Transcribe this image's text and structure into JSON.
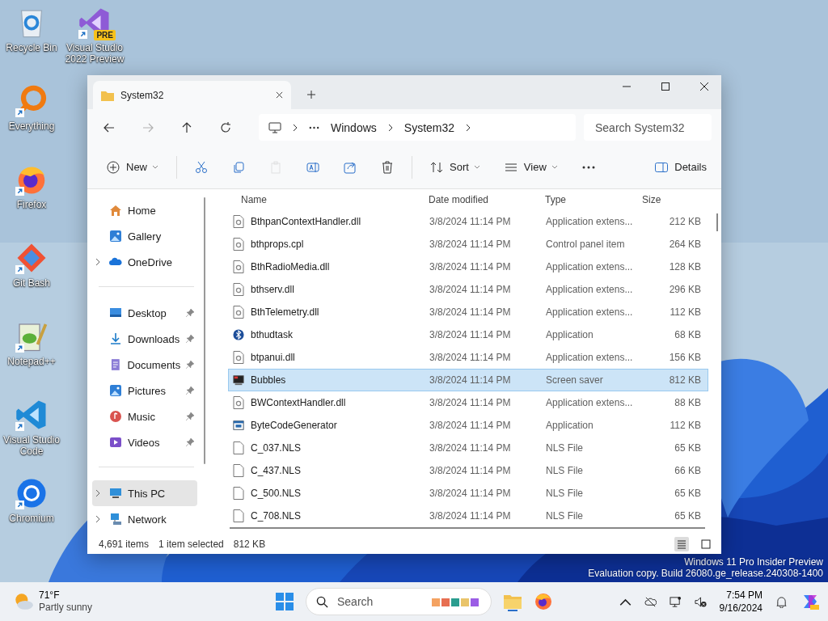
{
  "desktop_icons": [
    {
      "label": "Recycle Bin",
      "kind": "recycle",
      "shortcut": false
    },
    {
      "label": "Everything",
      "kind": "everything",
      "shortcut": true
    },
    {
      "label": "Firefox",
      "kind": "firefox",
      "shortcut": true
    },
    {
      "label": "Git Bash",
      "kind": "git",
      "shortcut": true
    },
    {
      "label": "Notepad++",
      "kind": "notepad",
      "shortcut": true
    },
    {
      "label": "Visual Studio Code",
      "kind": "vscode",
      "shortcut": true
    },
    {
      "label": "Chromium",
      "kind": "chromium",
      "shortcut": true
    },
    {
      "label": "Visual Studio 2022 Preview",
      "kind": "vs",
      "shortcut": true,
      "badge": "PRE"
    }
  ],
  "explorer": {
    "tab": {
      "title": "System32"
    },
    "address": [
      "Windows",
      "System32"
    ],
    "search": {
      "placeholder": "Search System32"
    },
    "toolbar": [
      {
        "kind": "new",
        "label": "New",
        "disabled": false
      },
      {
        "kind": "cut",
        "disabled": false
      },
      {
        "kind": "copy",
        "disabled": false
      },
      {
        "kind": "paste",
        "disabled": true
      },
      {
        "kind": "rename",
        "disabled": false
      },
      {
        "kind": "share",
        "disabled": false
      },
      {
        "kind": "delete",
        "disabled": false
      },
      {
        "kind": "sort",
        "label": "Sort",
        "disabled": false
      },
      {
        "kind": "view",
        "label": "View",
        "disabled": false
      },
      {
        "kind": "more",
        "disabled": false
      }
    ],
    "details_button": "Details",
    "sidebar": [
      [
        {
          "label": "Home",
          "kind": "home",
          "expandable": false,
          "pinned": false,
          "selected": false
        },
        {
          "label": "Gallery",
          "kind": "gallery",
          "expandable": false,
          "pinned": false,
          "selected": false
        },
        {
          "label": "OneDrive",
          "kind": "cloud",
          "expandable": true,
          "pinned": false,
          "selected": false
        }
      ],
      [
        {
          "label": "Desktop",
          "kind": "desktop",
          "expandable": false,
          "pinned": true,
          "selected": false
        },
        {
          "label": "Downloads",
          "kind": "download",
          "expandable": false,
          "pinned": true,
          "selected": false
        },
        {
          "label": "Documents",
          "kind": "document",
          "expandable": false,
          "pinned": true,
          "selected": false
        },
        {
          "label": "Pictures",
          "kind": "gallery",
          "expandable": false,
          "pinned": true,
          "selected": false
        },
        {
          "label": "Music",
          "kind": "music",
          "expandable": false,
          "pinned": true,
          "selected": false
        },
        {
          "label": "Videos",
          "kind": "video",
          "expandable": false,
          "pinned": true,
          "selected": false
        }
      ],
      [
        {
          "label": "This PC",
          "kind": "pc",
          "expandable": true,
          "pinned": false,
          "selected": true
        },
        {
          "label": "Network",
          "kind": "network",
          "expandable": true,
          "pinned": false,
          "selected": false
        }
      ]
    ],
    "columns": [
      "Name",
      "Date modified",
      "Type",
      "Size"
    ],
    "rows": [
      {
        "name": "BthpanContextHandler.dll",
        "date": "3/8/2024 11:14 PM",
        "type": "Application extens...",
        "size": "212 KB",
        "kind": "dll",
        "selected": false
      },
      {
        "name": "bthprops.cpl",
        "date": "3/8/2024 11:14 PM",
        "type": "Control panel item",
        "size": "264 KB",
        "kind": "dll",
        "selected": false
      },
      {
        "name": "BthRadioMedia.dll",
        "date": "3/8/2024 11:14 PM",
        "type": "Application extens...",
        "size": "128 KB",
        "kind": "dll",
        "selected": false
      },
      {
        "name": "bthserv.dll",
        "date": "3/8/2024 11:14 PM",
        "type": "Application extens...",
        "size": "296 KB",
        "kind": "dll",
        "selected": false
      },
      {
        "name": "BthTelemetry.dll",
        "date": "3/8/2024 11:14 PM",
        "type": "Application extens...",
        "size": "112 KB",
        "kind": "dll",
        "selected": false
      },
      {
        "name": "bthudtask",
        "date": "3/8/2024 11:14 PM",
        "type": "Application",
        "size": "68 KB",
        "kind": "bluetooth",
        "selected": false
      },
      {
        "name": "btpanui.dll",
        "date": "3/8/2024 11:14 PM",
        "type": "Application extens...",
        "size": "156 KB",
        "kind": "dll",
        "selected": false
      },
      {
        "name": "Bubbles",
        "date": "3/8/2024 11:14 PM",
        "type": "Screen saver",
        "size": "812 KB",
        "kind": "screensaver",
        "selected": true
      },
      {
        "name": "BWContextHandler.dll",
        "date": "3/8/2024 11:14 PM",
        "type": "Application extens...",
        "size": "88 KB",
        "kind": "dll",
        "selected": false
      },
      {
        "name": "ByteCodeGenerator",
        "date": "3/8/2024 11:14 PM",
        "type": "Application",
        "size": "112 KB",
        "kind": "app",
        "selected": false
      },
      {
        "name": "C_037.NLS",
        "date": "3/8/2024 11:14 PM",
        "type": "NLS File",
        "size": "65 KB",
        "kind": "file",
        "selected": false
      },
      {
        "name": "C_437.NLS",
        "date": "3/8/2024 11:14 PM",
        "type": "NLS File",
        "size": "66 KB",
        "kind": "file",
        "selected": false
      },
      {
        "name": "C_500.NLS",
        "date": "3/8/2024 11:14 PM",
        "type": "NLS File",
        "size": "65 KB",
        "kind": "file",
        "selected": false
      },
      {
        "name": "C_708.NLS",
        "date": "3/8/2024 11:14 PM",
        "type": "NLS File",
        "size": "65 KB",
        "kind": "file",
        "selected": false
      }
    ],
    "status": {
      "count": "4,691 items",
      "selection": "1 item selected",
      "size": "812 KB"
    },
    "view_modes": [
      {
        "kind": "details",
        "selected": true
      },
      {
        "kind": "tiles",
        "selected": false
      }
    ]
  },
  "watermark": [
    "Windows 11 Pro Insider Preview",
    "Evaluation copy. Build 26080.ge_release.240308-1400"
  ],
  "taskbar": {
    "weather": {
      "temp": "71°F",
      "condition": "Partly sunny"
    },
    "search": {
      "placeholder": "Search"
    },
    "time": "7:54 PM",
    "date": "9/16/2024"
  }
}
